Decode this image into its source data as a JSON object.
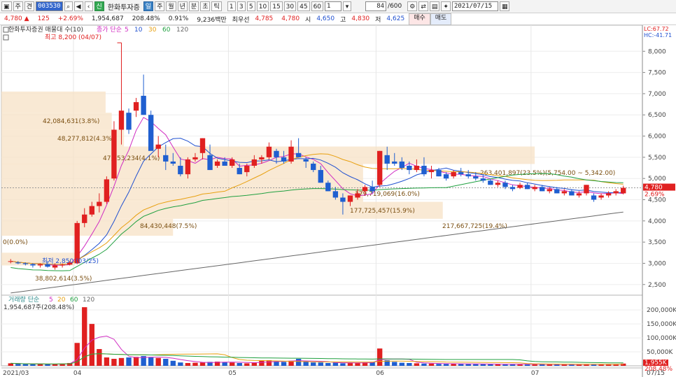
{
  "toolbar": {
    "period_label": "주",
    "period2_label": "견",
    "stock_code": "003530",
    "stock_name": "한화투자증",
    "tf_buttons": [
      "일",
      "주",
      "월",
      "년",
      "분",
      "초",
      "틱"
    ],
    "num_buttons": [
      "1",
      "3",
      "5",
      "10",
      "15",
      "30",
      "45",
      "60"
    ],
    "unit_value": "1",
    "count": "84",
    "count_total": "/600",
    "date": "2021/07/15",
    "sin_badge": "신"
  },
  "quote": {
    "price": "4,780",
    "change": "125",
    "pct": "+2.69%",
    "volume": "1,954,687",
    "vol_ratio": "208.48%",
    "turnover": "0.91%",
    "amount": "9,236백만",
    "pref_label": "최우선",
    "ask": "4,785",
    "bid": "4,780",
    "open_label": "시",
    "open": "4,650",
    "high_label": "고",
    "high": "4,830",
    "low_label": "저",
    "low": "4,625",
    "buy_label": "매수",
    "sell_label": "매도"
  },
  "colors": {
    "up": "#e02020",
    "down": "#1f5fd0",
    "ma5": "#d02cc2",
    "ma10": "#2050d0",
    "ma20": "#e8a010",
    "ma60": "#20a040",
    "ma120": "#666666",
    "band": "#f7e2c6"
  },
  "chart_data": {
    "type": "candlestick",
    "price_legend": {
      "title": "한화투자증권 매물대 수(10)",
      "ma_prefix": "종가 단순",
      "mas": [
        "5",
        "10",
        "30",
        "60",
        "120"
      ]
    },
    "volume_legend": {
      "title": "거래량 단순",
      "mas": [
        "5",
        "20",
        "60",
        "120"
      ],
      "value": "1,954,687주(208.48%)"
    },
    "y_axis_price": {
      "labels": [
        "8,000",
        "7,500",
        "7,000",
        "6,500",
        "6,000",
        "5,500",
        "5,000",
        "4,500",
        "4,000",
        "3,500",
        "3,000",
        "2,500"
      ],
      "range": [
        2150,
        8450
      ],
      "lc": "LC:67.72",
      "hc": "HC:-41.71",
      "last": "4,780",
      "last_pct": "2.69%"
    },
    "y_axis_volume": {
      "labels": [
        "200,000K",
        "150,000K",
        "100,000K",
        "50,000K"
      ],
      "max": 218000,
      "last": "1,955K",
      "last_pct": "208.48%"
    },
    "x_axis": {
      "labels": [
        "2021/03",
        "04",
        "05",
        "06",
        "07",
        "07/15"
      ],
      "label_index": [
        0,
        9,
        30,
        50,
        71,
        84
      ]
    },
    "annotations": {
      "high": "최고 8,200 (04/07)",
      "low": "최저 2,850 (03/25)"
    },
    "volume_profile": [
      {
        "label": "0(0.0%)",
        "lo": 3550,
        "hi": 3950,
        "w": 0.0
      },
      {
        "label": "38,802,614(3.5%)",
        "lo": 2950,
        "hi": 3250,
        "w": 0.12
      },
      {
        "label": "84,430,448(7.5%)",
        "lo": 3650,
        "hi": 4050,
        "w": 0.28
      },
      {
        "label": "217,667,725(19.4%)",
        "lo": 4050,
        "hi": 4450,
        "w": 0.72
      },
      {
        "label": "177,725,457(15.9%)",
        "lo": 4450,
        "hi": 4850,
        "w": 0.59
      },
      {
        "label": "179,719,069(16.0%)",
        "lo": 4850,
        "hi": 5350,
        "w": 0.59
      },
      {
        "label": "263,401,897(23.5%)(5,754.00 ~ 5,342.00)",
        "lo": 5342,
        "hi": 5754,
        "w": 0.87
      },
      {
        "label": "47,753,234(4.1%)",
        "lo": 5754,
        "hi": 6150,
        "w": 0.2
      },
      {
        "label": "48,277,812(4.3%)",
        "lo": 6150,
        "hi": 6550,
        "w": 0.18
      },
      {
        "label": "42,084,631(3.8%)",
        "lo": 6550,
        "hi": 7050,
        "w": 0.17
      }
    ],
    "candles": [
      [
        3050,
        3100,
        3000,
        3050
      ],
      [
        3020,
        3050,
        2980,
        3000
      ],
      [
        3000,
        3020,
        2950,
        2980
      ],
      [
        2980,
        3000,
        2900,
        2950
      ],
      [
        2950,
        3000,
        2900,
        2980
      ],
      [
        2980,
        3050,
        2900,
        2920
      ],
      [
        2900,
        3000,
        2850,
        2950
      ],
      [
        2950,
        3000,
        2900,
        2970
      ],
      [
        2970,
        3050,
        2950,
        3020
      ],
      [
        3000,
        4000,
        2980,
        3950
      ],
      [
        3950,
        4300,
        3850,
        4150
      ],
      [
        4150,
        4450,
        4100,
        4350
      ],
      [
        4350,
        4650,
        4200,
        4450
      ],
      [
        4450,
        5050,
        4400,
        4980
      ],
      [
        5000,
        6350,
        4950,
        6150
      ],
      [
        6150,
        8200,
        5800,
        6600
      ],
      [
        6550,
        6650,
        6050,
        6150
      ],
      [
        6600,
        6900,
        6450,
        6800
      ],
      [
        6950,
        7450,
        6500,
        6500
      ],
      [
        6500,
        6600,
        5800,
        5650
      ],
      [
        5700,
        6000,
        5500,
        5800
      ],
      [
        5550,
        5800,
        5200,
        5400
      ],
      [
        5400,
        5600,
        5300,
        5350
      ],
      [
        5300,
        5500,
        5050,
        5100
      ],
      [
        5100,
        5500,
        5000,
        5450
      ],
      [
        5450,
        5600,
        5400,
        5500
      ],
      [
        5600,
        5950,
        5450,
        5950
      ],
      [
        5550,
        5800,
        5200,
        5200
      ],
      [
        5300,
        5450,
        5250,
        5400
      ],
      [
        5400,
        5500,
        5300,
        5300
      ],
      [
        5300,
        5500,
        5250,
        5450
      ],
      [
        5250,
        5350,
        5100,
        5100
      ],
      [
        5150,
        5350,
        5050,
        5300
      ],
      [
        5300,
        5550,
        5250,
        5450
      ],
      [
        5450,
        5550,
        5350,
        5500
      ],
      [
        5500,
        5850,
        5450,
        5750
      ],
      [
        5650,
        5700,
        5350,
        5500
      ],
      [
        5500,
        5650,
        5350,
        5400
      ],
      [
        5400,
        5900,
        5350,
        5750
      ],
      [
        5600,
        5950,
        5500,
        5500
      ],
      [
        5450,
        5500,
        5250,
        5400
      ],
      [
        5350,
        5400,
        5150,
        5200
      ],
      [
        5200,
        5300,
        4900,
        4900
      ],
      [
        4900,
        4950,
        4700,
        4700
      ],
      [
        4700,
        4800,
        4500,
        4550
      ],
      [
        4550,
        4650,
        4150,
        4450
      ],
      [
        4450,
        4600,
        4350,
        4600
      ],
      [
        4550,
        4750,
        4500,
        4650
      ],
      [
        4700,
        4850,
        4600,
        4800
      ],
      [
        4800,
        4950,
        4650,
        4700
      ],
      [
        4850,
        5650,
        4800,
        5650
      ],
      [
        5550,
        5750,
        5200,
        5350
      ],
      [
        5400,
        5600,
        5300,
        5350
      ],
      [
        5400,
        5500,
        5200,
        5250
      ],
      [
        5300,
        5400,
        5100,
        5200
      ],
      [
        5200,
        5450,
        5150,
        5300
      ],
      [
        5300,
        5500,
        5050,
        5100
      ],
      [
        5150,
        5300,
        5000,
        5200
      ],
      [
        5200,
        5250,
        5050,
        5050
      ],
      [
        5100,
        5150,
        4950,
        5000
      ],
      [
        5050,
        5200,
        5000,
        5150
      ],
      [
        5150,
        5250,
        5050,
        5100
      ],
      [
        5100,
        5200,
        5000,
        5050
      ],
      [
        5050,
        5150,
        4950,
        5000
      ],
      [
        5000,
        5100,
        4900,
        4950
      ],
      [
        4950,
        5000,
        4850,
        4850
      ],
      [
        4850,
        4950,
        4800,
        4900
      ],
      [
        4900,
        4950,
        4750,
        4800
      ],
      [
        4800,
        4850,
        4700,
        4750
      ],
      [
        4780,
        4900,
        4750,
        4850
      ],
      [
        4850,
        4900,
        4750,
        4750
      ],
      [
        4750,
        4850,
        4700,
        4800
      ],
      [
        4800,
        4850,
        4700,
        4700
      ],
      [
        4700,
        4800,
        4650,
        4750
      ],
      [
        4750,
        4800,
        4650,
        4650
      ],
      [
        4650,
        4750,
        4600,
        4700
      ],
      [
        4700,
        4750,
        4600,
        4600
      ],
      [
        4600,
        4700,
        4550,
        4650
      ],
      [
        4650,
        4850,
        4600,
        4850
      ],
      [
        4600,
        4650,
        4450,
        4500
      ],
      [
        4550,
        4650,
        4500,
        4600
      ],
      [
        4600,
        4700,
        4550,
        4650
      ],
      [
        4650,
        4750,
        4600,
        4700
      ],
      [
        4650,
        4830,
        4625,
        4780
      ]
    ],
    "volumes": [
      9000,
      7000,
      6000,
      5500,
      6000,
      5000,
      7000,
      8000,
      10000,
      82000,
      210000,
      150000,
      60000,
      30000,
      25000,
      28000,
      30000,
      32000,
      35000,
      30000,
      28000,
      25000,
      18000,
      12000,
      10000,
      11000,
      12000,
      14000,
      15000,
      13000,
      12000,
      10000,
      9000,
      12000,
      18000,
      20000,
      16000,
      14000,
      18000,
      25000,
      15000,
      12000,
      12000,
      10000,
      11000,
      9000,
      10000,
      11000,
      12000,
      14000,
      62000,
      20000,
      14000,
      11000,
      10000,
      9000,
      8000,
      8000,
      7000,
      7000,
      7500,
      7000,
      6500,
      6000,
      6000,
      5500,
      5500,
      6000,
      5500,
      6000,
      5500,
      5000,
      5000,
      5000,
      4800,
      4800,
      4500,
      4800,
      6000,
      5000,
      5000,
      5000,
      5500,
      8000
    ]
  }
}
